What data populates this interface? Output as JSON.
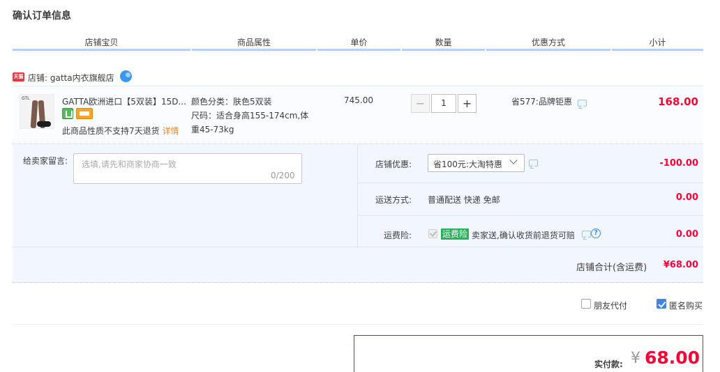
{
  "page": {
    "title": "确认订单信息"
  },
  "columns": [
    "店铺宝贝",
    "商品属性",
    "单价",
    "数量",
    "优惠方式",
    "小计"
  ],
  "shop": {
    "tmall_badge": "天猫",
    "name": "店铺: gatta内衣旗舰店"
  },
  "item": {
    "title": "GATTA欧洲进口【5双装】15D...",
    "no_return_text": "此商品性质不支持7天退货",
    "no_return_link": "详情",
    "props": [
      "颜色分类：肤色5双装",
      "尺码：适合身高155-174cm,体",
      "重45-73kg"
    ],
    "price": "745.00",
    "quantity": {
      "minus": "−",
      "value": "1",
      "plus": "+"
    },
    "promo": "省577:品牌钜惠",
    "subtotal": "168.00"
  },
  "message": {
    "label": "给卖家留言:",
    "placeholder": "选填,请先和商家协商一致",
    "count": "0/200"
  },
  "shop_discount": {
    "label": "店铺优惠:",
    "selected": "省100元:大淘特惠",
    "amount": "-100.00"
  },
  "shipping": {
    "label": "运送方式:",
    "value": "普通配送 快递 免邮",
    "amount": "0.00"
  },
  "insurance": {
    "label": "运费险:",
    "tag": "运费险",
    "desc": "卖家送,确认收货前退货可赔",
    "help": "?",
    "amount": "0.00"
  },
  "shop_total": {
    "label": "店铺合计(含运费)",
    "value": "¥68.00"
  },
  "options": {
    "friend_pay": "朋友代付",
    "anonymous": "匿名购买",
    "friend_pay_checked": false,
    "anonymous_checked": true
  },
  "payment": {
    "label": "实付款:",
    "currency": "¥",
    "value": "68.00"
  },
  "colors": {
    "accent_red": "#ff0036",
    "header_line": "#b2d1ff",
    "panel_bg": "#f2f7ff",
    "tag_green": "#28b05a",
    "checkbox_blue": "#3d86e2"
  }
}
